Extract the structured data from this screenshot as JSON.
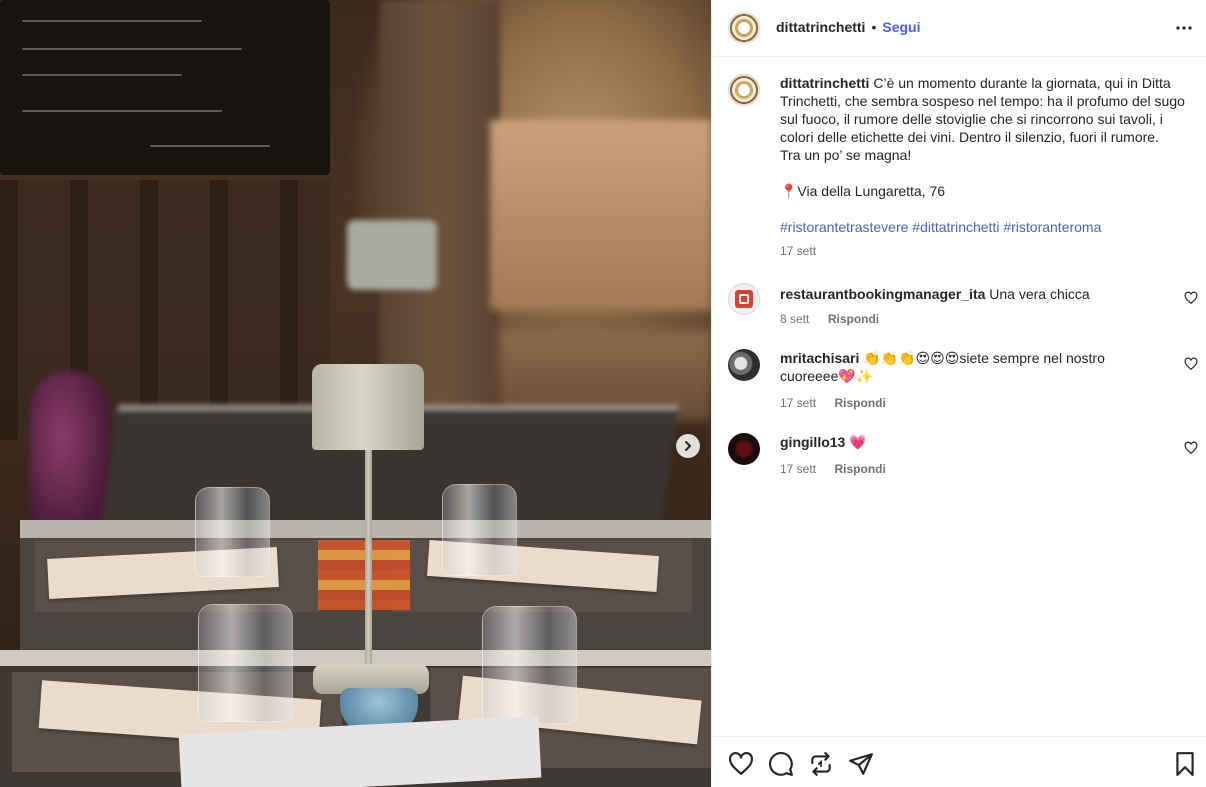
{
  "post": {
    "author": "dittatrinchetti",
    "separator": "•",
    "follow_label": "Segui",
    "caption_lines": [
      "C’è un momento durante la giornata, qui in Ditta Trinchetti, che sembra sospeso nel tempo: ha il profumo del sugo sul fuoco, il rumore delle stoviglie che si rincorrono sui tavoli, i colori delle etichette dei vini. Dentro il silenzio, fuori il rumore.",
      "Tra un po’ se magna!"
    ],
    "location": "📍Via della Lungaretta, 76",
    "hashtags": "#ristorantetrastevere #dittatrinchetti #ristoranteroma",
    "date": "17 sett"
  },
  "comments": [
    {
      "username": "restaurantbookingmanager_ita",
      "text": "Una vera chicca",
      "date": "8 sett",
      "reply_label": "Rispondi"
    },
    {
      "username": "mritachisari",
      "text": "👏👏👏😍😍😍siete sempre nel nostro cuoreeee💖✨",
      "date": "17 sett",
      "reply_label": "Rispondi"
    },
    {
      "username": "gingillo13",
      "text": "💗",
      "date": "17 sett",
      "reply_label": "Rispondi"
    }
  ],
  "icons": {
    "more": "more-horizontal-icon",
    "next": "chevron-right-icon",
    "like": "heart-icon",
    "comment": "comment-icon",
    "share": "share-icon",
    "repost": "repost-icon",
    "save": "bookmark-icon"
  },
  "colors": {
    "accent": "#4a5df9",
    "hashtag": "#4a64b7",
    "muted": "#737373"
  }
}
